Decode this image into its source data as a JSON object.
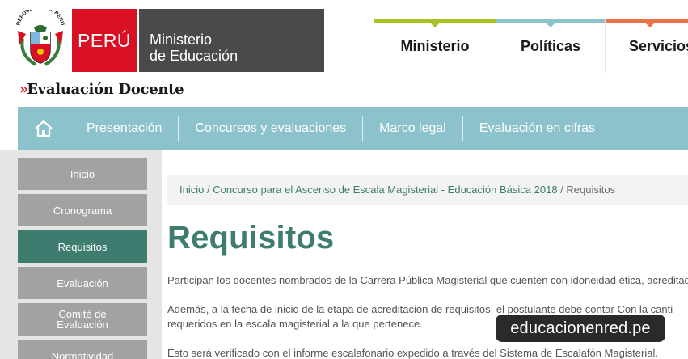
{
  "header": {
    "escudo_text": "REPÚBLICA DEL PERÚ",
    "peru_label": "PERÚ",
    "ministry_line1": "Ministerio",
    "ministry_line2": "de Educación",
    "brand_mark": "»",
    "brand_title": "Evaluación Docente",
    "top_tabs": [
      {
        "label": "Ministerio",
        "color": "#a6c41e"
      },
      {
        "label": "Políticas",
        "color": "#8cc2cb"
      },
      {
        "label": "Servicios",
        "color": "#ee7148"
      }
    ]
  },
  "nav": {
    "home_icon": "home-icon",
    "items": [
      "Presentación",
      "Concursos y evaluaciones",
      "Marco legal",
      "Evaluación en cifras"
    ]
  },
  "sidebar": {
    "items": [
      {
        "label": "Inicio",
        "active": false
      },
      {
        "label": "Cronograma",
        "active": false
      },
      {
        "label": "Requisitos",
        "active": true
      },
      {
        "label": "Evaluación",
        "active": false
      },
      {
        "label": "Comité de Evaluación",
        "active": false
      },
      {
        "label": "Normatividad",
        "active": false
      }
    ]
  },
  "breadcrumb": {
    "home": "Inicio",
    "sep": " / ",
    "parent": "Concurso para el Ascenso de Escala Magisterial - Educación Básica 2018",
    "current": "Requisitos"
  },
  "main": {
    "title": "Requisitos",
    "p1": "Participan los docentes nombrados de la Carrera Pública Magisterial que cuenten con idoneidad ética,  acreditada",
    "p2_line1": "Además, a la fecha de inicio de la etapa de acreditación de requisitos, el postulante debe contar Con la canti",
    "p2_line2": "requeridos en la escala magisterial a la que pertenece.",
    "p3": "Esto será verificado con el informe escalafonario expedido a través del Sistema de Escalafón Magisterial."
  },
  "watermark": "educacionenred.pe",
  "colors": {
    "peru_red": "#d91023",
    "ministry_gray": "#4a4a4a",
    "nav_teal": "#8cc2cb",
    "accent_green": "#3d7c6f",
    "sidebar_gray": "#a2a2a2"
  }
}
